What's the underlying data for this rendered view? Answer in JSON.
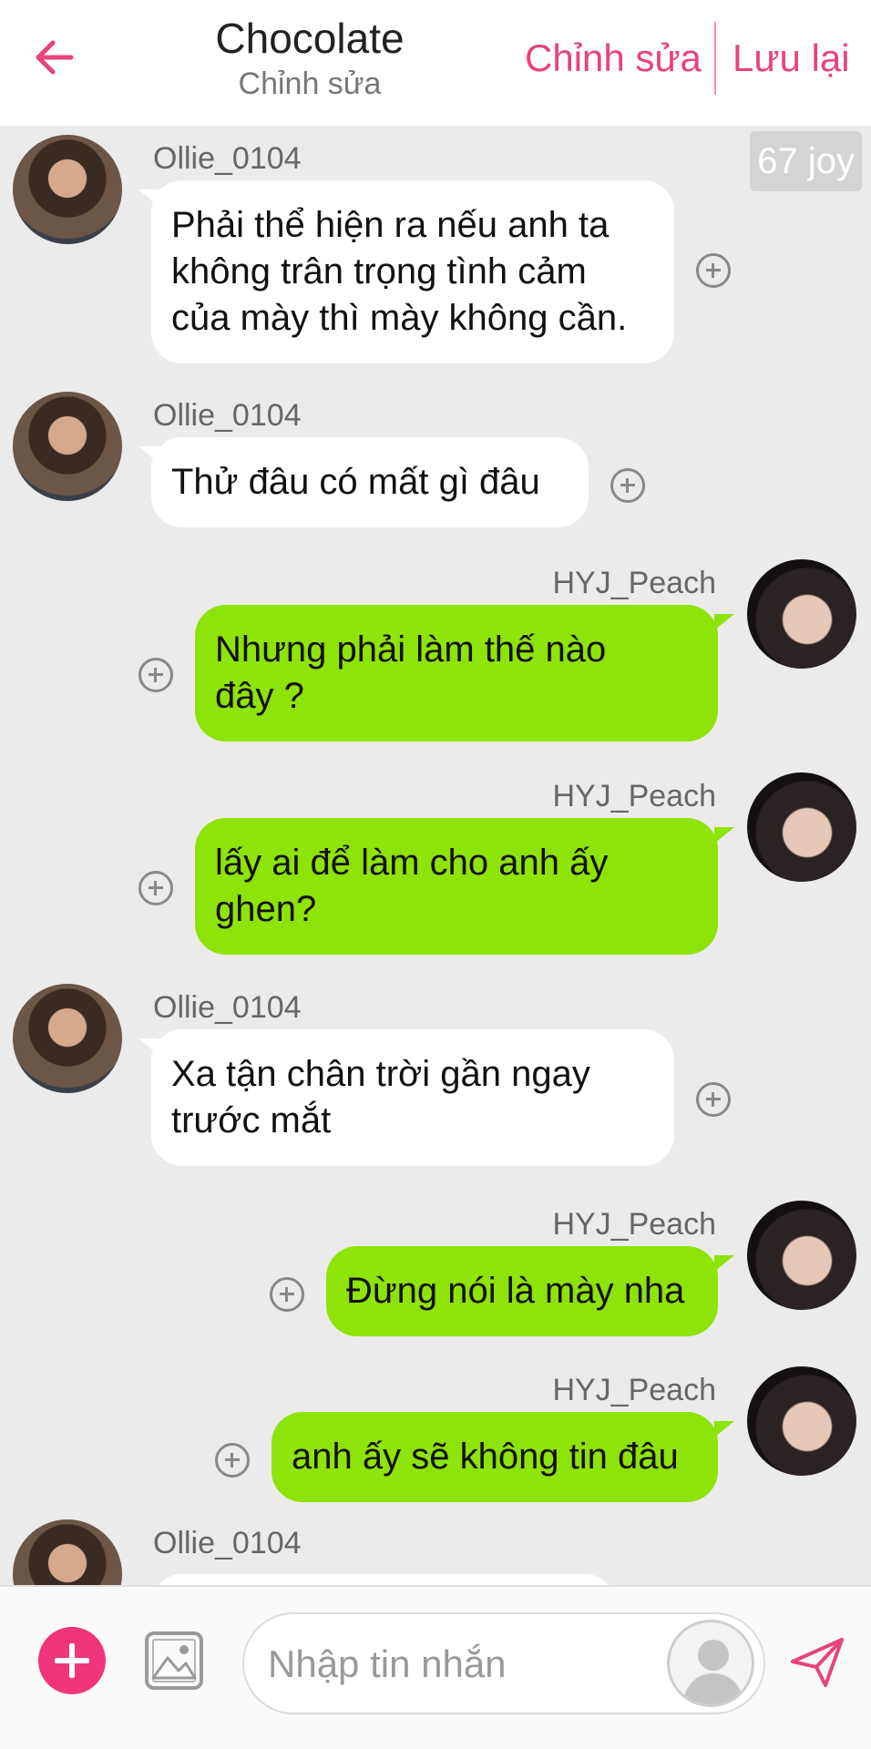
{
  "header": {
    "title": "Chocolate",
    "subtitle": "Chỉnh sửa",
    "edit_label": "Chỉnh sửa",
    "save_label": "Lưu lại",
    "accent_color": "#e8437c"
  },
  "joy_badge": "67 joy",
  "messages": [
    {
      "sender": "Ollie_0104",
      "side": "left",
      "text": "Phải thể hiện ra nếu anh ta\nkhông trân trọng tình cảm\ncủa mày thì mày không cần."
    },
    {
      "sender": "Ollie_0104",
      "side": "left",
      "text": "Thử đâu có mất gì đâu"
    },
    {
      "sender": "HYJ_Peach",
      "side": "right",
      "text": "Nhưng phải làm thế nào\nđây ?"
    },
    {
      "sender": "HYJ_Peach",
      "side": "right",
      "text": "lấy ai để làm cho anh ấy\nghen?"
    },
    {
      "sender": "Ollie_0104",
      "side": "left",
      "text": "Xa tận chân trời gần ngay\ntrước mắt"
    },
    {
      "sender": "HYJ_Peach",
      "side": "right",
      "text": "Đừng nói là mày nha"
    },
    {
      "sender": "HYJ_Peach",
      "side": "right",
      "text": "anh ấy sẽ không tin đâu"
    },
    {
      "sender": "Ollie_0104",
      "side": "left",
      "text": ""
    }
  ],
  "input": {
    "placeholder": "Nhập tin nhắn"
  },
  "icons": {
    "back": "arrow-left-icon",
    "add": "plus-icon",
    "image": "image-icon",
    "persona": "user-silhouette-icon",
    "send": "paper-plane-icon",
    "react": "plus-circle-icon"
  },
  "colors": {
    "outgoing_bubble": "#8ee308",
    "incoming_bubble": "#ffffff",
    "add_button": "#f0357a",
    "background": "#ebebeb"
  }
}
